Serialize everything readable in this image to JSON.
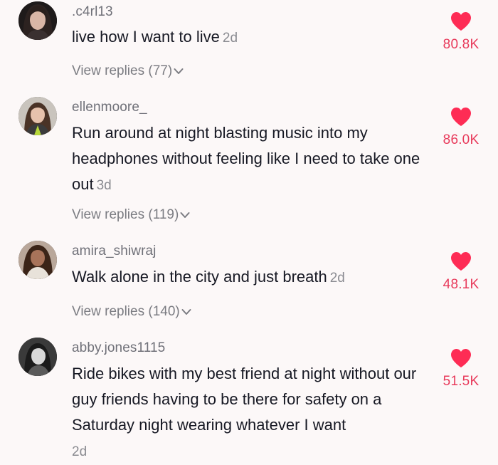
{
  "colors": {
    "background": "#fcf8f8",
    "like_red": "#fe2c55",
    "username_gray": "#6f7078",
    "text": "#161823"
  },
  "comments": [
    {
      "username": ".c4rl13",
      "text": "live how I want to live",
      "time": "2d",
      "likes": "80.8K",
      "replies": "View replies (77)",
      "like_icon": "heart-icon",
      "replies_icon": "chevron-down-icon"
    },
    {
      "username": "ellenmoore_",
      "text": "Run around at night blasting music into my headphones without feeling like I need to take one out",
      "time": "3d",
      "likes": "86.0K",
      "replies": "View replies (119)",
      "like_icon": "heart-icon",
      "replies_icon": "chevron-down-icon"
    },
    {
      "username": "amira_shiwraj",
      "text": "Walk alone in the city and just breath",
      "time": "2d",
      "likes": "48.1K",
      "replies": "View replies (140)",
      "like_icon": "heart-icon",
      "replies_icon": "chevron-down-icon"
    },
    {
      "username": "abby.jones1115",
      "text": "Ride bikes with my best friend at night without our guy friends having to be there for safety on a Saturday night wearing whatever I want",
      "time": "2d",
      "likes": "51.5K",
      "like_icon": "heart-icon"
    }
  ]
}
